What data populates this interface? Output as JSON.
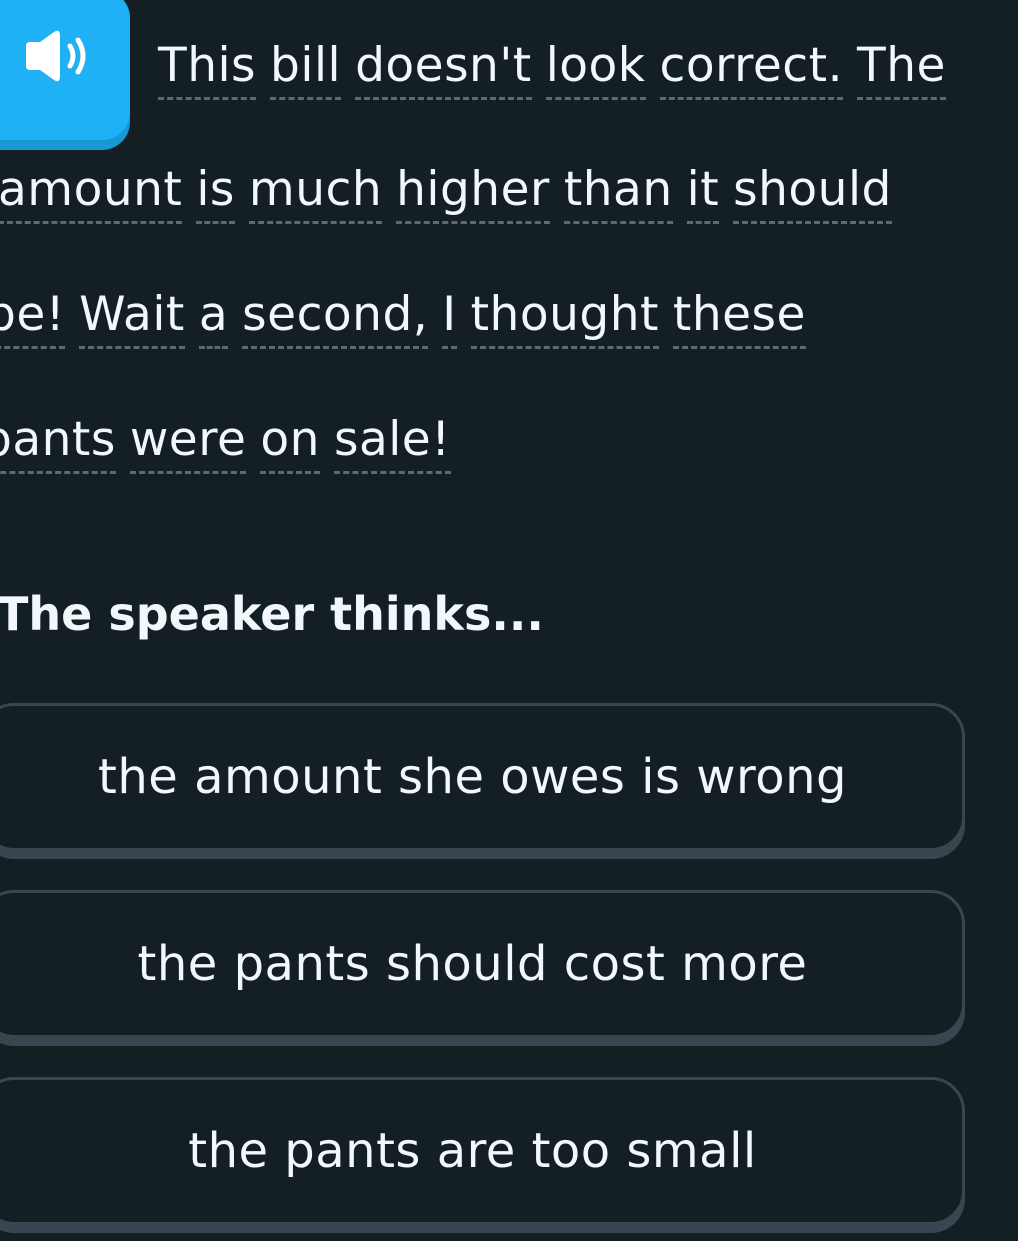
{
  "audio": {
    "icon": "speaker-icon",
    "button_color": "#1fb0f6"
  },
  "sentence": {
    "lines": [
      [
        "This",
        "bill",
        "doesn't",
        "look",
        "correct.",
        "The"
      ],
      [
        "amount",
        "is",
        "much",
        "higher",
        "than",
        "it",
        "should"
      ],
      [
        "be!",
        "Wait",
        "a",
        "second,",
        "I",
        "thought",
        "these"
      ],
      [
        "pants",
        "were",
        "on",
        "sale!"
      ]
    ]
  },
  "question": {
    "prompt": "The speaker thinks..."
  },
  "options": [
    {
      "label": "the amount she owes is wrong"
    },
    {
      "label": "the pants should cost more"
    },
    {
      "label": "the pants are too small"
    }
  ],
  "colors": {
    "background": "#141f23",
    "text": "#f1f7fb",
    "border": "#37464f",
    "underline": "#5b6b73"
  }
}
